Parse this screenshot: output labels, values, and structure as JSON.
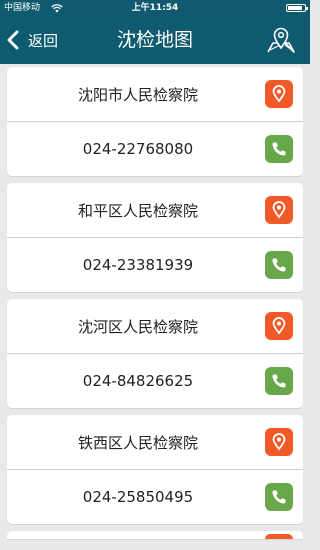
{
  "status_bar": {
    "carrier": "中国移动",
    "time": "上午11:54",
    "icons": [
      "wifi-icon",
      "battery-icon"
    ]
  },
  "nav": {
    "back_label": "返回",
    "title": "沈检地图",
    "back_icon": "chevron-left-icon",
    "map_icon": "map-pin-icon"
  },
  "colors": {
    "nav_background": "#0e5a6e",
    "location_button": "#f05a28",
    "call_button": "#69a84a",
    "page_background": "#e9e9e9"
  },
  "procuratorates": [
    {
      "name": "沈阳市人民检察院",
      "phone": "024-22768080"
    },
    {
      "name": "和平区人民检察院",
      "phone": "024-23381939"
    },
    {
      "name": "沈河区人民检察院",
      "phone": "024-84826625"
    },
    {
      "name": "铁西区人民检察院",
      "phone": "024-25850495"
    }
  ]
}
